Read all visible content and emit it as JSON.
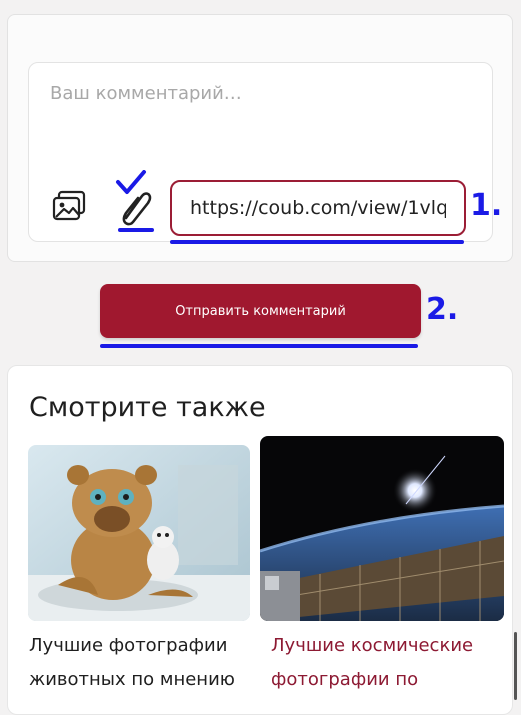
{
  "comment_form": {
    "placeholder": "Ваш комментарий…",
    "url_value": "https://coub.com/view/1vlq"
  },
  "submit_label": "Отправить комментарий",
  "annotations": {
    "step1": "1.",
    "step2": "2."
  },
  "see_also": {
    "title": "Смотрите также",
    "articles": [
      {
        "title_line1": "Лучшие фотографии",
        "title_line2": "животных по мнению",
        "image": "toy-lemur-photo"
      },
      {
        "title_line1": "Лучшие космические",
        "title_line2": "фотографии по",
        "image": "space-station-photo"
      }
    ]
  },
  "colors": {
    "accent": "#9b1d35",
    "button": "#a0182f",
    "annotation": "#1a1ae6"
  }
}
